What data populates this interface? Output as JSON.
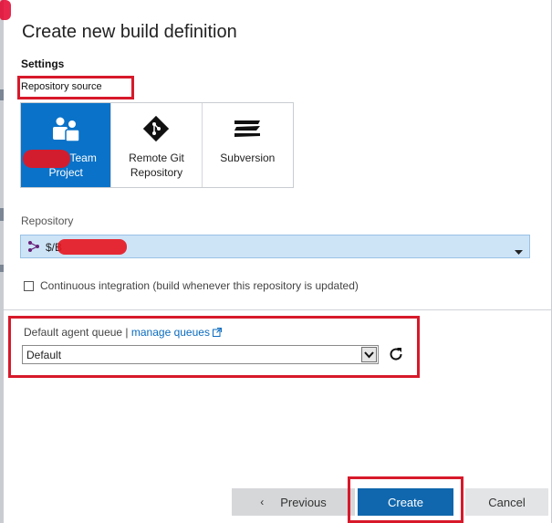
{
  "dialog": {
    "title": "Create new build definition"
  },
  "settings": {
    "section_label": "Settings",
    "repository_source_label": "Repository source",
    "sources": [
      {
        "label_line1": "Team",
        "label_line2": "Project",
        "icon": "team-project-icon",
        "selected": true
      },
      {
        "label_line1": "Remote Git",
        "label_line2": "Repository",
        "icon": "git-icon",
        "selected": false
      },
      {
        "label_line1": "Subversion",
        "label_line2": "",
        "icon": "subversion-icon",
        "selected": false
      }
    ]
  },
  "repository": {
    "label": "Repository",
    "value": "$/B"
  },
  "ci": {
    "label": "Continuous integration (build whenever this repository is updated)",
    "checked": false
  },
  "queue": {
    "label": "Default agent queue | ",
    "manage_link": "manage queues",
    "value": "Default"
  },
  "buttons": {
    "previous": "Previous",
    "create": "Create",
    "cancel": "Cancel"
  },
  "colors": {
    "accent": "#0a72c8",
    "create_button": "#1067ad",
    "selected_row": "#cde4f7",
    "annotation_red": "#d7192a",
    "link": "#0a6bbf"
  }
}
